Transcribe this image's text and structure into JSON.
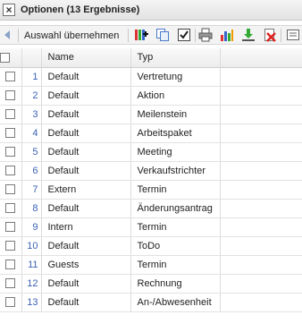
{
  "window": {
    "title": "Optionen (13 Ergebnisse)"
  },
  "toolbar": {
    "apply_label": "Auswahl übernehmen",
    "icons": [
      "back-arrow-icon",
      "add-column-icon",
      "copy-icon",
      "checkbox-icon",
      "print-icon",
      "chart-icon",
      "export-icon",
      "delete-icon",
      "more-icon"
    ]
  },
  "table": {
    "headers": {
      "name": "Name",
      "typ": "Typ"
    },
    "rows": [
      {
        "num": "1",
        "name": "Default",
        "typ": "Vertretung"
      },
      {
        "num": "2",
        "name": "Default",
        "typ": "Aktion"
      },
      {
        "num": "3",
        "name": "Default",
        "typ": "Meilenstein"
      },
      {
        "num": "4",
        "name": "Default",
        "typ": "Arbeitspaket"
      },
      {
        "num": "5",
        "name": "Default",
        "typ": "Meeting"
      },
      {
        "num": "6",
        "name": "Default",
        "typ": "Verkaufstrichter"
      },
      {
        "num": "7",
        "name": "Extern",
        "typ": "Termin"
      },
      {
        "num": "8",
        "name": "Default",
        "typ": "Änderungsantrag"
      },
      {
        "num": "9",
        "name": "Intern",
        "typ": "Termin"
      },
      {
        "num": "10",
        "name": "Default",
        "typ": "ToDo"
      },
      {
        "num": "11",
        "name": "Guests",
        "typ": "Termin"
      },
      {
        "num": "12",
        "name": "Default",
        "typ": "Rechnung"
      },
      {
        "num": "13",
        "name": "Default",
        "typ": "An-/Abwesenheit"
      }
    ]
  },
  "colors": {
    "link": "#3a62b5",
    "header_bg": "#ececec"
  }
}
